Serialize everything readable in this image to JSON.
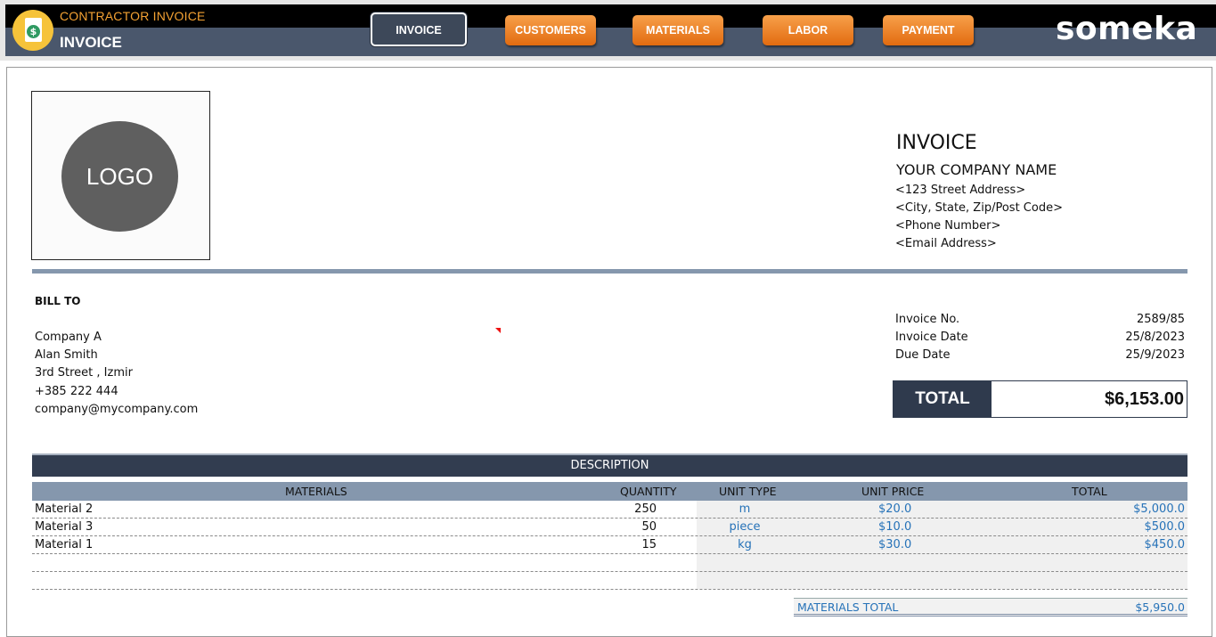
{
  "app": {
    "title": "CONTRACTOR INVOICE",
    "page": "INVOICE",
    "brand": "someka"
  },
  "nav": {
    "invoice": "INVOICE",
    "customers": "CUSTOMERS",
    "materials": "MATERIALS",
    "labor": "LABOR",
    "payment": "PAYMENT"
  },
  "logo": {
    "text": "LOGO"
  },
  "company": {
    "heading": "INVOICE",
    "name": "YOUR COMPANY NAME",
    "address": "<123 Street Address>",
    "city": "<City, State, Zip/Post Code>",
    "phone": "<Phone Number>",
    "email": "<Email Address>"
  },
  "bill_to": {
    "label": "BILL TO",
    "company": "Company A",
    "contact": "Alan Smith",
    "street": "3rd Street , Izmir",
    "phone": "+385 222 444",
    "email": "company@mycompany.com"
  },
  "meta": {
    "invoice_no_label": "Invoice  No.",
    "invoice_no": "2589/85",
    "invoice_date_label": "Invoice Date",
    "invoice_date": "25/8/2023",
    "due_date_label": "Due Date",
    "due_date": "25/9/2023"
  },
  "total": {
    "label": "TOTAL",
    "value": "$6,153.00"
  },
  "table": {
    "section": "DESCRIPTION",
    "headers": {
      "materials": "MATERIALS",
      "quantity": "QUANTITY",
      "unit_type": "UNIT TYPE",
      "unit_price": "UNIT PRICE",
      "total": "TOTAL"
    },
    "rows": [
      {
        "name": "Material 2",
        "qty": "250",
        "unit": "m",
        "price": "$20.0",
        "total": "$5,000.0"
      },
      {
        "name": "Material 3",
        "qty": "50",
        "unit": "piece",
        "price": "$10.0",
        "total": "$500.0"
      },
      {
        "name": "Material 1",
        "qty": "15",
        "unit": "kg",
        "price": "$30.0",
        "total": "$450.0"
      }
    ],
    "materials_total_label": "MATERIALS TOTAL",
    "materials_total": "$5,950.0"
  },
  "colors": {
    "header_slate": "#4a576c",
    "accent_orange": "#e26b10",
    "dark_navy": "#2f3a4d",
    "link_blue": "#2672b8"
  }
}
